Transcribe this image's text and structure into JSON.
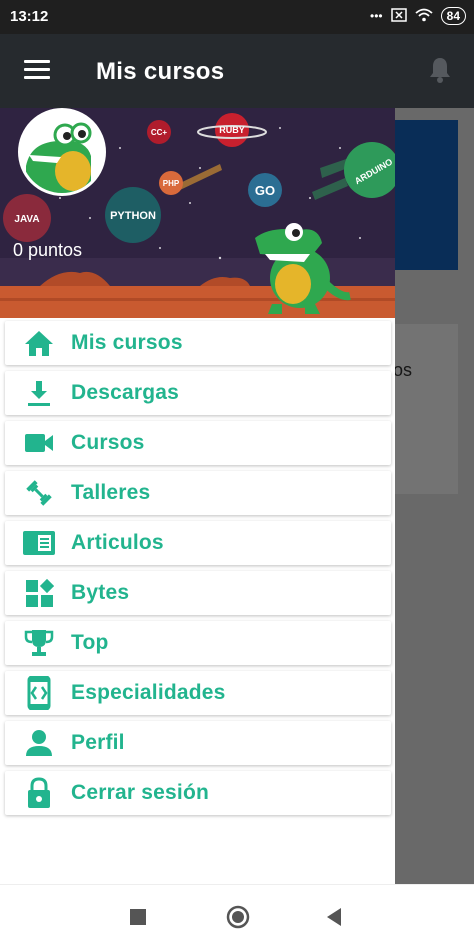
{
  "status_bar": {
    "time": "13:12",
    "dots": "•••",
    "battery": "84"
  },
  "app_bar": {
    "title": "Mis cursos"
  },
  "background_content": {
    "peek_text": "os"
  },
  "drawer": {
    "header": {
      "points_text": "0 puntos",
      "planet_labels": {
        "java": "JAVA",
        "python": "PYTHON",
        "php": "PHP",
        "cc": "CC+",
        "ruby": "RUBY",
        "go": "GO",
        "arduino": "ARDUINO"
      }
    },
    "menu": [
      {
        "label": "Mis cursos",
        "icon": "home-icon"
      },
      {
        "label": "Descargas",
        "icon": "download-icon"
      },
      {
        "label": "Cursos",
        "icon": "video-camera-icon"
      },
      {
        "label": "Talleres",
        "icon": "dumbbell-icon"
      },
      {
        "label": "Articulos",
        "icon": "article-icon"
      },
      {
        "label": "Bytes",
        "icon": "widgets-icon"
      },
      {
        "label": "Top",
        "icon": "trophy-icon"
      },
      {
        "label": "Especialidades",
        "icon": "code-device-icon"
      },
      {
        "label": "Perfil",
        "icon": "person-icon"
      },
      {
        "label": "Cerrar sesión",
        "icon": "lock-icon"
      }
    ]
  },
  "colors": {
    "accent": "#22b48e",
    "app_bar": "#262a2e",
    "status_bar": "#1f1f1f",
    "header_bg": "#2f2341"
  }
}
